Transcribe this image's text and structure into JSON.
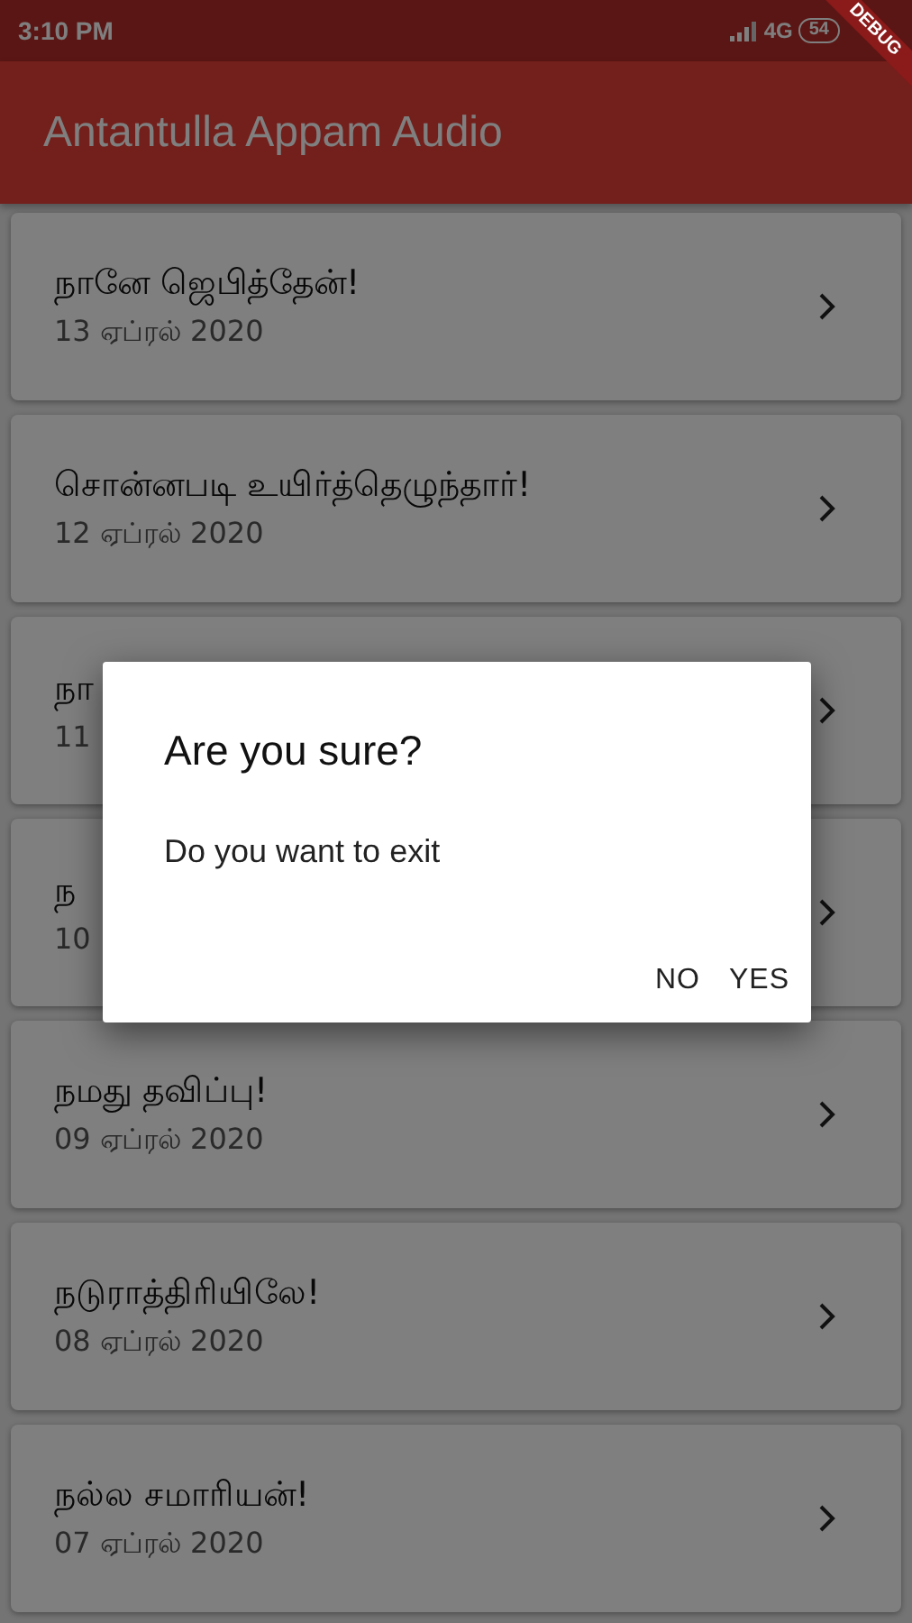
{
  "status_bar": {
    "time": "3:10 PM",
    "network": "4G",
    "battery": "54"
  },
  "debug_banner": "DEBUG",
  "app_bar": {
    "title": "Antantulla Appam Audio"
  },
  "items": [
    {
      "title": "நானே ஜெபித்தேன்!",
      "date": "13 ஏப்ரல் 2020"
    },
    {
      "title": "சொன்னபடி உயிர்த்தெழுந்தார்!",
      "date": "12 ஏப்ரல் 2020"
    },
    {
      "title": "நா",
      "date": "11"
    },
    {
      "title": "ந",
      "date": "10"
    },
    {
      "title": "நமது தவிப்பு!",
      "date": "09 ஏப்ரல் 2020"
    },
    {
      "title": "நடுராத்திரியிலே!",
      "date": "08 ஏப்ரல் 2020"
    },
    {
      "title": "நல்ல சமாரியன்!",
      "date": "07  ஏப்ரல் 2020"
    }
  ],
  "dialog": {
    "title": "Are you sure?",
    "message": "Do you want to exit",
    "buttons": [
      "NO",
      "YES"
    ]
  }
}
